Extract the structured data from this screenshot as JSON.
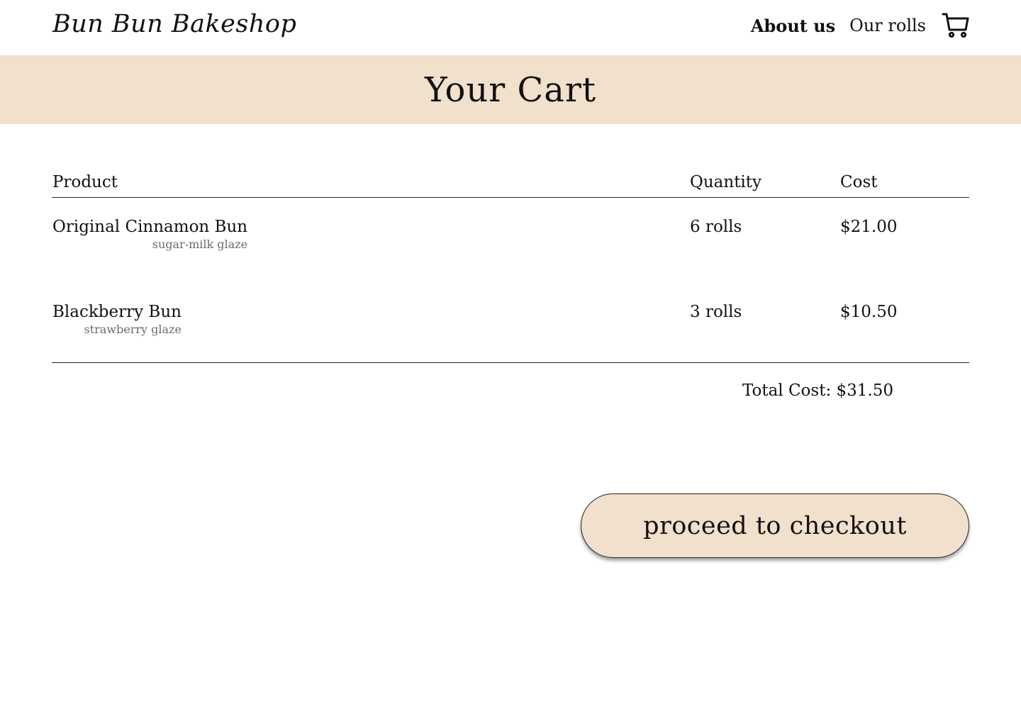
{
  "header": {
    "logo": "Bun Bun Bakeshop",
    "nav": {
      "about_label": "About us",
      "rolls_label": "Our rolls",
      "cart_icon": "shopping-cart-icon"
    }
  },
  "banner": {
    "title": "Your Cart"
  },
  "cart": {
    "columns": {
      "product": "Product",
      "quantity": "Quantity",
      "cost": "Cost"
    },
    "items": [
      {
        "name": "Original Cinnamon Bun",
        "glaze": "sugar-milk glaze",
        "quantity": "6 rolls",
        "cost": "$21.00"
      },
      {
        "name": "Blackberry Bun",
        "glaze": "strawberry glaze",
        "quantity": "3 rolls",
        "cost": "$10.50"
      }
    ],
    "total": "Total Cost: $31.50"
  },
  "checkout": {
    "label": "proceed to checkout"
  },
  "colors": {
    "accent": "#f1e0cb",
    "text": "#111111",
    "muted": "#6b6b6b"
  }
}
